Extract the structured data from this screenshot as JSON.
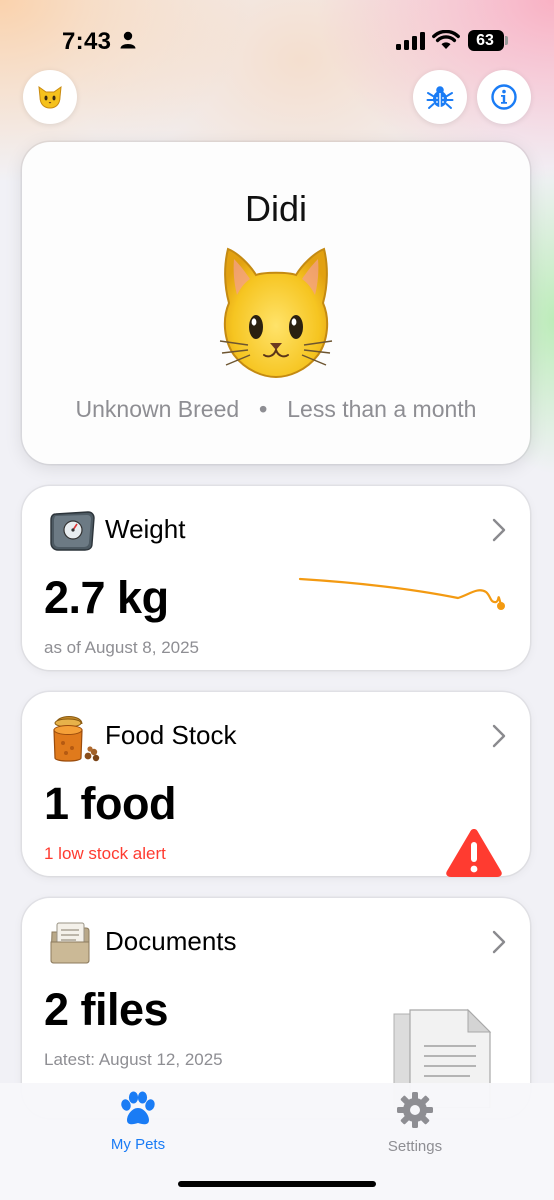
{
  "status_bar": {
    "time": "7:43",
    "battery": "63",
    "icons": [
      "person-icon",
      "cellular-signal-icon",
      "wifi-icon",
      "battery-icon"
    ]
  },
  "header": {
    "left_button_icon": "cat-face-icon",
    "right_buttons": [
      "bug-icon",
      "info-icon"
    ]
  },
  "pet": {
    "name": "Didi",
    "avatar_icon": "cat-face-emoji",
    "breed": "Unknown Breed",
    "separator": "•",
    "age": "Less than a month"
  },
  "weight_card": {
    "icon": "scale-icon",
    "title": "Weight",
    "value": "2.7 kg",
    "subtitle": "as of August 8, 2025",
    "trend_color": "#f39a12"
  },
  "food_card": {
    "icon": "food-can-icon",
    "title": "Food Stock",
    "value": "1 food",
    "subtitle": "1 low stock alert",
    "alert_icon": "warning-icon",
    "alert_color": "#ff3b30"
  },
  "documents_card": {
    "icon": "file-folder-icon",
    "title": "Documents",
    "value": "2 files",
    "subtitle": "Latest: August 12, 2025",
    "decor_icon": "document-page-icon"
  },
  "tab_bar": {
    "tabs": [
      {
        "label": "My Pets",
        "icon": "paw-icon",
        "selected": true
      },
      {
        "label": "Settings",
        "icon": "gear-icon",
        "selected": false
      }
    ],
    "active_color": "#1a7cf5",
    "inactive_color": "#8e8e93"
  }
}
